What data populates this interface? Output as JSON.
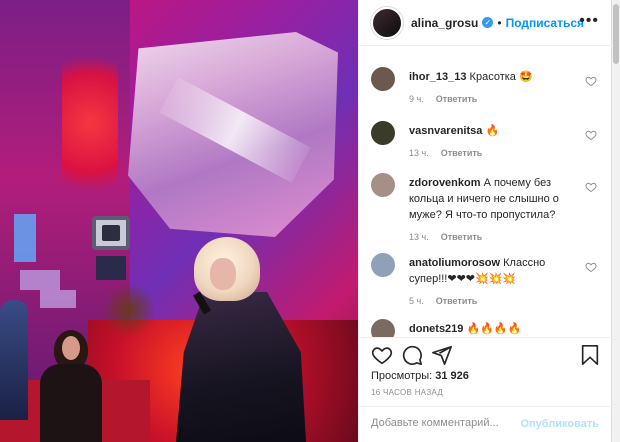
{
  "header": {
    "username": "alina_grosu",
    "separator": "•",
    "follow_label": "Подписаться",
    "more_icon": "•••"
  },
  "comments": [
    {
      "user": "ihor_13_13",
      "text": "Красотка 🤩",
      "time": "9 ч.",
      "reply": "Ответить",
      "avatar_color": "#6a5a4e"
    },
    {
      "user": "vasnvarenitsa",
      "text": "🔥",
      "time": "13 ч.",
      "reply": "Ответить",
      "avatar_color": "#3b3b2a"
    },
    {
      "user": "zdorovenkom",
      "text": "А почему без кольца и ничего не слышно о муже? Я что-то пропустила?",
      "time": "13 ч.",
      "reply": "Ответить",
      "avatar_color": "#a58f87"
    },
    {
      "user": "anatoliumorosow",
      "text": "Классно супер!!!❤❤❤💥💥💥",
      "time": "5 ч.",
      "reply": "Ответить",
      "avatar_color": "#8fa0b8"
    },
    {
      "user": "donets219",
      "text": "🔥🔥🔥🔥",
      "time": "",
      "reply": "",
      "avatar_color": "#7a6a60"
    }
  ],
  "actions": {
    "views_label": "Просмотры:",
    "views_count": "31 926",
    "time_ago": "16 ЧАСОВ НАЗАД"
  },
  "add_comment": {
    "placeholder": "Добавьте комментарий...",
    "publish_label": "Опубликовать"
  },
  "colors": {
    "link_blue": "#0095f6",
    "publish_disabled": "#b2dffc",
    "muted_text": "#8e8e8e"
  },
  "icons": [
    "verified-badge-icon",
    "more-options-icon",
    "heart-icon",
    "comment-icon",
    "share-icon",
    "bookmark-icon"
  ]
}
